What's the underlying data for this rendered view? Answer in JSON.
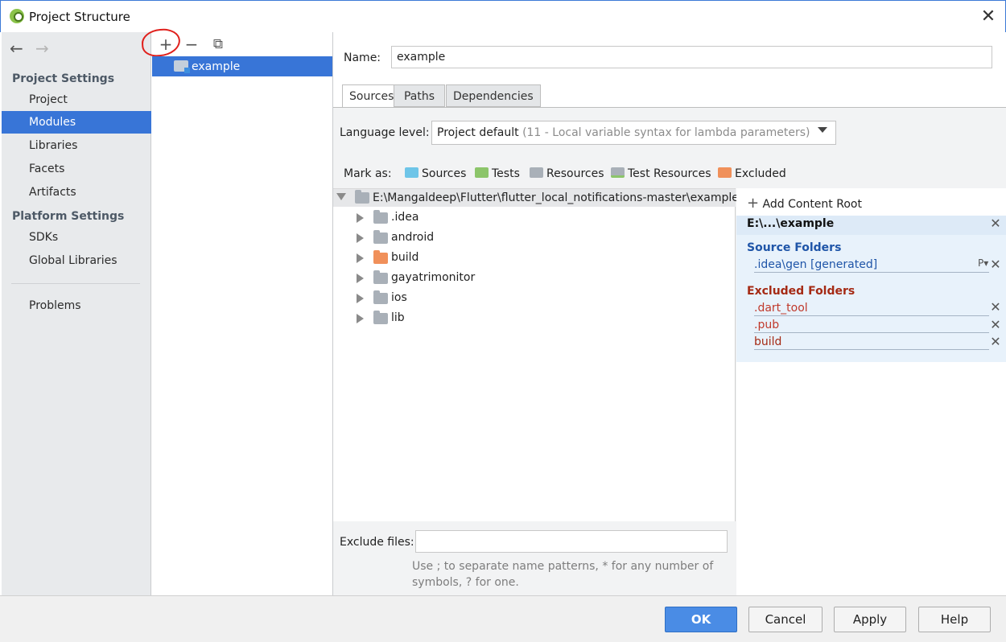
{
  "window": {
    "title": "Project Structure",
    "close_glyph": "✕"
  },
  "nav": {
    "back_glyph": "←",
    "forward_glyph": "→",
    "sections": [
      {
        "title": "Project Settings",
        "items": [
          "Project",
          "Modules",
          "Libraries",
          "Facets",
          "Artifacts"
        ]
      },
      {
        "title": "Platform Settings",
        "items": [
          "SDKs",
          "Global Libraries"
        ]
      }
    ],
    "bottom_items": [
      "Problems"
    ],
    "active_item": "Modules"
  },
  "module_toolbar": {
    "add_glyph": "+",
    "remove_glyph": "−",
    "copy_glyph": "⧉"
  },
  "modules": [
    "example"
  ],
  "module": {
    "name_label": "Name:",
    "name_value": "example",
    "tabs": [
      "Sources",
      "Paths",
      "Dependencies"
    ],
    "active_tab": "Sources"
  },
  "language_level": {
    "label": "Language level:",
    "value": "Project default",
    "detail": "(11 - Local variable syntax for lambda parameters)"
  },
  "mark_as": {
    "label": "Mark as:",
    "items": [
      {
        "label": "Sources",
        "color": "#6ec5e8"
      },
      {
        "label": "Tests",
        "color": "#8cc56a"
      },
      {
        "label": "Resources",
        "color": "#a9b0b8"
      },
      {
        "label": "Test Resources",
        "color": "#a9b0b8"
      },
      {
        "label": "Excluded",
        "color": "#f0905a"
      }
    ]
  },
  "tree": {
    "root": "E:\\Mangaldeep\\Flutter\\flutter_local_notifications-master\\example",
    "children": [
      {
        "label": ".idea",
        "color": "#a9b0b8"
      },
      {
        "label": "android",
        "color": "#a9b0b8"
      },
      {
        "label": "build",
        "color": "#f0905a"
      },
      {
        "label": "gayatrimonitor",
        "color": "#a9b0b8"
      },
      {
        "label": "ios",
        "color": "#a9b0b8"
      },
      {
        "label": "lib",
        "color": "#a9b0b8"
      }
    ]
  },
  "content_roots": {
    "add_label": "Add Content Root",
    "root_title": "E:\\...\\example",
    "source_title": "Source Folders",
    "source_folders": [
      ".idea\\gen [generated]"
    ],
    "source_props_glyph": "P▾",
    "excluded_title": "Excluded Folders",
    "excluded_folders": [
      ".dart_tool",
      ".pub",
      "build"
    ],
    "remove_glyph": "✕",
    "colors": {
      "source": "#1f55a8",
      "excluded": "#a52a14"
    }
  },
  "exclude_files": {
    "label": "Exclude files:",
    "value": "",
    "hint": "Use ; to separate name patterns, * for any number of symbols, ? for one."
  },
  "buttons": {
    "ok": "OK",
    "cancel": "Cancel",
    "apply": "Apply",
    "help": "Help"
  }
}
